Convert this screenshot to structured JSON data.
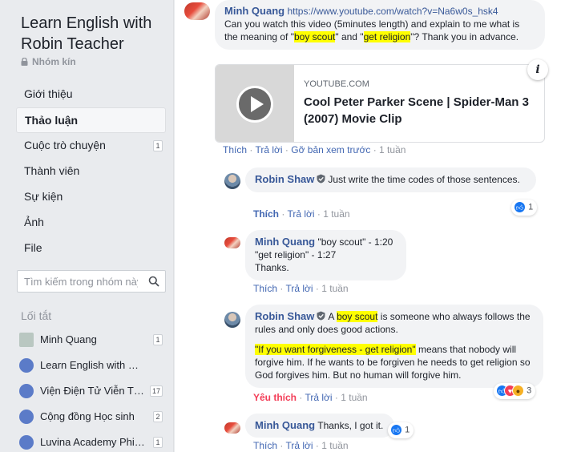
{
  "sidebar": {
    "group_name": "Learn English with Robin Teacher",
    "group_type": "Nhóm kín",
    "nav": [
      {
        "label": "Giới thiệu"
      },
      {
        "label": "Thảo luận"
      },
      {
        "label": "Cuộc trò chuyện",
        "badge": "1"
      },
      {
        "label": "Thành viên"
      },
      {
        "label": "Sự kiện"
      },
      {
        "label": "Ảnh"
      },
      {
        "label": "File"
      }
    ],
    "search_placeholder": "Tìm kiếm trong nhóm này",
    "shortcuts_title": "Lối tắt",
    "shortcuts": [
      {
        "label": "Minh Quang",
        "badge": "1"
      },
      {
        "label": "Learn English with Robin Teacher",
        "badge": ""
      },
      {
        "label": "Viện Điện Tử Viễn Thông",
        "badge": "17"
      },
      {
        "label": "Cộng đồng Học sinh",
        "badge": "2"
      },
      {
        "label": "Luvina Academy Phitrada",
        "badge": "1"
      }
    ]
  },
  "post": {
    "author": "Minh Quang",
    "url": "https://www.youtube.com/watch?v=Na6w0s_hsk4",
    "text_1": "Can you watch this video (5minutes length) and explain to me what is the meaning of \"",
    "hl_1": "boy scout",
    "text_2": "\" and \"",
    "hl_2": "get religion",
    "text_3": "\"? Thank you in advance.",
    "card": {
      "domain": "YOUTUBE.COM",
      "title": "Cool Peter Parker Scene | Spider-Man 3 (2007) Movie Clip",
      "info": "i"
    },
    "actions": {
      "like": "Thích",
      "reply": "Trả lời",
      "remove_preview": "Gỡ bản xem trước",
      "time": "1 tuần"
    }
  },
  "replies": [
    {
      "author": "Robin Shaw",
      "text": "Just write the time codes of those sentences.",
      "like": "Thích",
      "reply": "Trả lời",
      "time": "1 tuần",
      "reaction_count": "1"
    },
    {
      "author": "Minh Quang",
      "line_1": "\"boy scout\" - 1:20",
      "line_2": "\"get religion\" - 1:27",
      "line_3": "Thanks.",
      "like": "Thích",
      "reply": "Trả lời",
      "time": "1 tuần"
    },
    {
      "author": "Robin Shaw",
      "pre": "A ",
      "hl": "boy scout",
      "post": " is someone who always follows the rules and only does good actions.",
      "hl_2": "\"If you want forgiveness - get religion\"",
      "post_2": " means that nobody will forgive him. If he wants to be forgiven he needs to get religion so God forgives him. But no human will forgive him.",
      "like": "Yêu thích",
      "reply": "Trả lời",
      "time": "1 tuần",
      "reaction_count": "3"
    },
    {
      "author": "Minh Quang",
      "text": "Thanks, I got it.",
      "like": "Thích",
      "reply": "Trả lời",
      "time": "1 tuần",
      "reaction_count": "1"
    }
  ],
  "separator": " · ",
  "colors": {
    "link": "#385898",
    "highlight": "#ffff00",
    "love": "#f33e58",
    "like": "#1877f2"
  }
}
